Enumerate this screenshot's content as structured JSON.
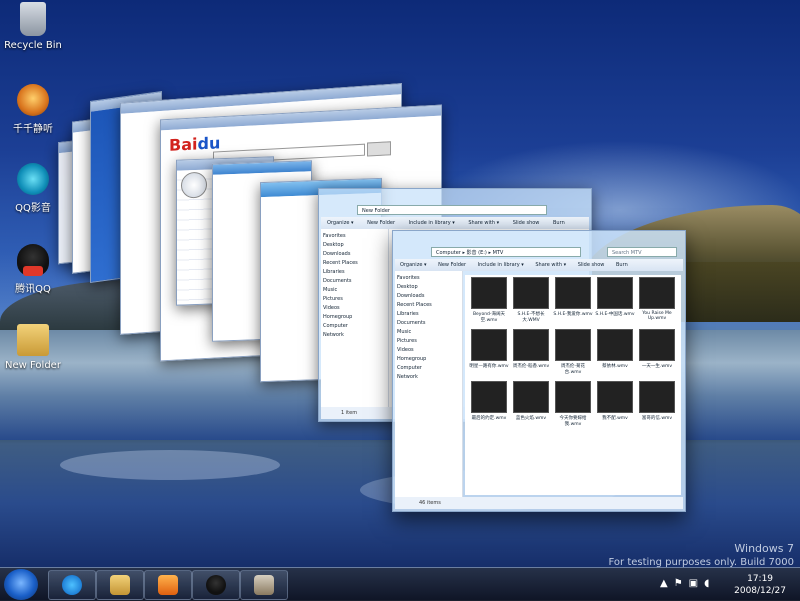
{
  "desktop": {
    "icons": [
      {
        "label": "Recycle Bin",
        "icon": "recycle-bin-icon"
      },
      {
        "label": "千千静听",
        "icon": "ttplayer-icon"
      },
      {
        "label": "QQ影音",
        "icon": "qqplayer-icon"
      },
      {
        "label": "腾讯QQ",
        "icon": "qq-penguin-icon"
      },
      {
        "label": "New Folder",
        "icon": "folder-icon"
      }
    ]
  },
  "windows": {
    "new_folder": {
      "breadcrumb": "New Folder",
      "toolbar": [
        "Organize ▾",
        "New Folder",
        "Include in library ▾",
        "Share with ▾",
        "Slide show",
        "Burn"
      ],
      "nav": [
        "Favorites",
        "Desktop",
        "Downloads",
        "Recent Places",
        "Libraries",
        "Documents",
        "Music",
        "Pictures",
        "Videos",
        "Homegroup",
        "Computer",
        "Network"
      ],
      "status": "1 item"
    },
    "mtv": {
      "breadcrumb": "Computer ▸ 影音 (E:) ▸ MTV",
      "search_placeholder": "Search MTV",
      "toolbar": [
        "Organize ▾",
        "New Folder",
        "Include in library ▾",
        "Share with ▾",
        "Slide show",
        "Burn"
      ],
      "nav": [
        "Favorites",
        "Desktop",
        "Downloads",
        "Recent Places",
        "Libraries",
        "Documents",
        "Music",
        "Pictures",
        "Videos",
        "Homegroup",
        "Computer",
        "Network"
      ],
      "status": "46 items",
      "files": [
        "Beyond-海阔天空.wmv",
        "S.H.E-不想长大.WMV",
        "S.H.E-我爱你.wmv",
        "S.H.E-中国话.wmv",
        "You Raise Me Up.wmv",
        "明星—路有你.wmv",
        "周杰伦-稻香.wmv",
        "周杰伦-菊花台.wmv",
        "蔡依林.wmv",
        "一天一生.wmv",
        "最后的约定.wmv",
        "蓝色火焰.wmv",
        "今天你要嫁给我.wmv",
        "我不配.wmv",
        "富哥的信.wmv"
      ]
    }
  },
  "watermark": {
    "line1": "Windows 7",
    "line2": "For testing purposes only. Build 7000"
  },
  "taskbar": {
    "pinned": [
      {
        "name": "Internet Explorer",
        "icon": "internet-explorer-icon"
      },
      {
        "name": "Windows Explorer",
        "icon": "windows-explorer-icon"
      },
      {
        "name": "Windows Media Player",
        "icon": "media-player-icon"
      },
      {
        "name": "腾讯QQ",
        "icon": "qq-penguin-icon"
      },
      {
        "name": "Tools",
        "icon": "tools-icon"
      }
    ],
    "clock_time": "17:19",
    "clock_date": "2008/12/27"
  }
}
